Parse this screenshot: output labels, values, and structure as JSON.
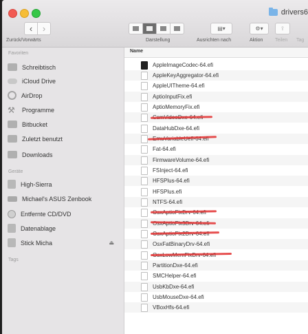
{
  "window": {
    "title": "drivers6"
  },
  "toolbar": {
    "nav_label": "Zurück/Vorwärts",
    "view_label": "Darstellung",
    "arrange_label": "Ausrichten nach",
    "action_label": "Aktion",
    "share_label": "Teilen",
    "tags_label": "Tag"
  },
  "sidebar": {
    "favorites_header": "Favoriten",
    "favorites": [
      {
        "label": "Schreibtisch",
        "icon": "desktop-icon"
      },
      {
        "label": "iCloud Drive",
        "icon": "cloud-icon"
      },
      {
        "label": "AirDrop",
        "icon": "airdrop-icon"
      },
      {
        "label": "Programme",
        "icon": "apps-icon"
      },
      {
        "label": "Bitbucket",
        "icon": "folder-icon"
      },
      {
        "label": "Zuletzt benutzt",
        "icon": "recents-icon"
      },
      {
        "label": "Downloads",
        "icon": "folder-icon"
      }
    ],
    "devices_header": "Geräte",
    "devices": [
      {
        "label": "High-Sierra",
        "icon": "disk-icon"
      },
      {
        "label": "Michael's ASUS Zenbook",
        "icon": "laptop-icon"
      },
      {
        "label": "Entfernte CD/DVD",
        "icon": "cd-icon"
      },
      {
        "label": "Datenablage",
        "icon": "disk-icon"
      },
      {
        "label": "Stick Micha",
        "icon": "disk-icon"
      }
    ],
    "tags_header": "Tags",
    "eject_glyph": "⏏"
  },
  "content": {
    "column_name": "Name",
    "files": [
      {
        "name": "AppleImageCodec-64.efi"
      },
      {
        "name": "AppleKeyAggregator-64.efi"
      },
      {
        "name": "AppleUITheme-64.efi"
      },
      {
        "name": "AptioInputFix.efi"
      },
      {
        "name": "AptioMemoryFix.efi"
      },
      {
        "name": "CsmVideoDxe-64.efi"
      },
      {
        "name": "DataHubDxe-64.efi"
      },
      {
        "name": "EmuVariableUefi-64.efi"
      },
      {
        "name": "Fat-64.efi"
      },
      {
        "name": "FirmwareVolume-64.efi"
      },
      {
        "name": "FSInject-64.efi"
      },
      {
        "name": "HFSPlus-64.efi"
      },
      {
        "name": "HFSPlus.efi"
      },
      {
        "name": "NTFS-64.efi"
      },
      {
        "name": "OsxAptioFixDrv-64.efi"
      },
      {
        "name": "OsxAptioFix3Drv-64.efi"
      },
      {
        "name": "OsxAptioFix2Drv-64.efi"
      },
      {
        "name": "OsxFatBinaryDrv-64.efi"
      },
      {
        "name": "OsxLowMemFixDrv-64.efi"
      },
      {
        "name": "PartitionDxe-64.efi"
      },
      {
        "name": "SMCHelper-64.efi"
      },
      {
        "name": "UsbKbDxe-64.efi"
      },
      {
        "name": "UsbMouseDxe-64.efi"
      },
      {
        "name": "VBoxHfs-64.efi"
      }
    ]
  }
}
